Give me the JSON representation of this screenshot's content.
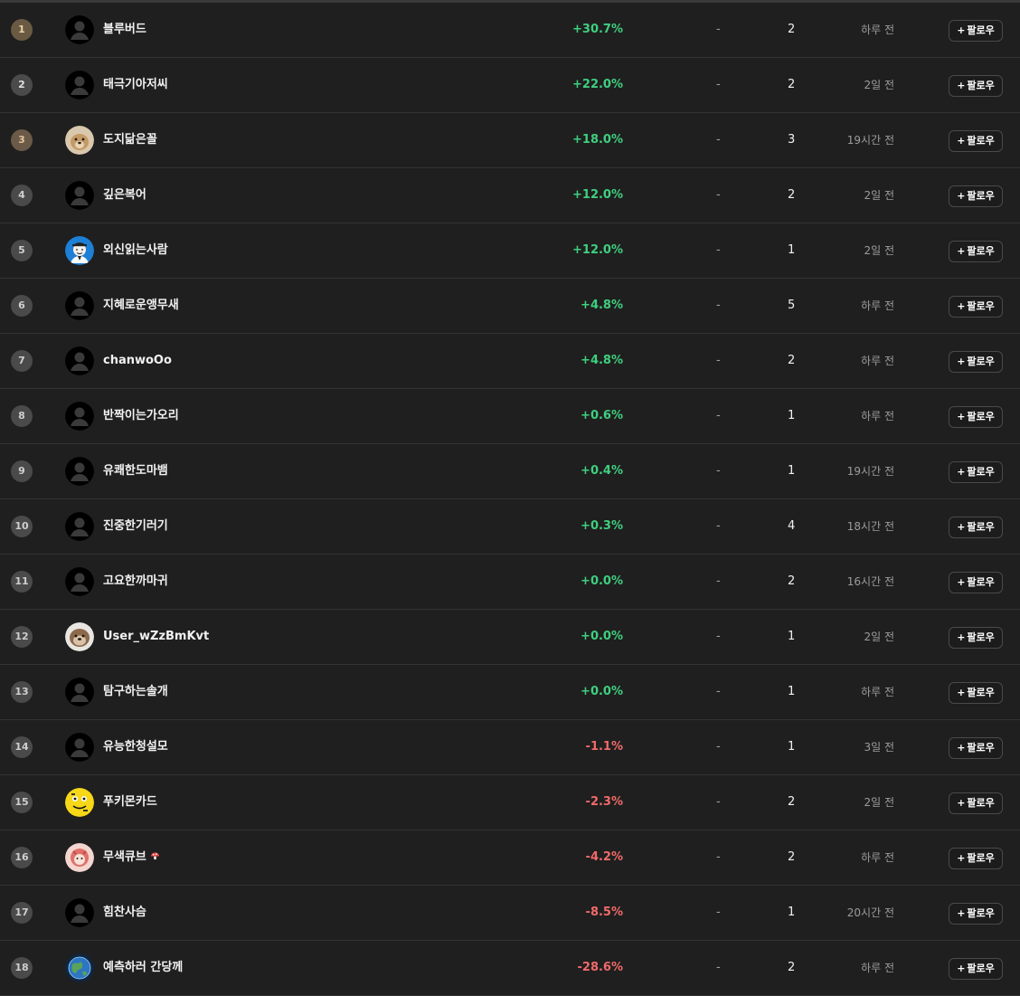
{
  "leaderboard": {
    "rows": [
      {
        "rank": "1",
        "name": "블루버드",
        "change": "+30.7%",
        "trend": "pos",
        "dash": "-",
        "count": "2",
        "time": "하루 전",
        "follow": "팔로우",
        "avatar": "default-avatar",
        "medal": "medal-1"
      },
      {
        "rank": "2",
        "name": "태극기아저씨",
        "change": "+22.0%",
        "trend": "pos",
        "dash": "-",
        "count": "2",
        "time": "2일 전",
        "follow": "팔로우",
        "avatar": "default-avatar",
        "medal": "medal-2"
      },
      {
        "rank": "3",
        "name": "도지닮은꼴",
        "change": "+18.0%",
        "trend": "pos",
        "dash": "-",
        "count": "3",
        "time": "19시간 전",
        "follow": "팔로우",
        "avatar": "dog-avatar",
        "medal": "medal-3"
      },
      {
        "rank": "4",
        "name": "깊은복어",
        "change": "+12.0%",
        "trend": "pos",
        "dash": "-",
        "count": "2",
        "time": "2일 전",
        "follow": "팔로우",
        "avatar": "default-avatar",
        "medal": ""
      },
      {
        "rank": "5",
        "name": "외신읽는사람",
        "change": "+12.0%",
        "trend": "pos",
        "dash": "-",
        "count": "1",
        "time": "2일 전",
        "follow": "팔로우",
        "avatar": "portrait-avatar",
        "medal": ""
      },
      {
        "rank": "6",
        "name": "지혜로운앵무새",
        "change": "+4.8%",
        "trend": "pos",
        "dash": "-",
        "count": "5",
        "time": "하루 전",
        "follow": "팔로우",
        "avatar": "default-avatar",
        "medal": ""
      },
      {
        "rank": "7",
        "name": "chanwoOo",
        "change": "+4.8%",
        "trend": "pos",
        "dash": "-",
        "count": "2",
        "time": "하루 전",
        "follow": "팔로우",
        "avatar": "default-avatar",
        "medal": ""
      },
      {
        "rank": "8",
        "name": "반짝이는가오리",
        "change": "+0.6%",
        "trend": "pos",
        "dash": "-",
        "count": "1",
        "time": "하루 전",
        "follow": "팔로우",
        "avatar": "default-avatar",
        "medal": ""
      },
      {
        "rank": "9",
        "name": "유쾌한도마뱀",
        "change": "+0.4%",
        "trend": "pos",
        "dash": "-",
        "count": "1",
        "time": "19시간 전",
        "follow": "팔로우",
        "avatar": "default-avatar",
        "medal": ""
      },
      {
        "rank": "10",
        "name": "진중한기러기",
        "change": "+0.3%",
        "trend": "pos",
        "dash": "-",
        "count": "4",
        "time": "18시간 전",
        "follow": "팔로우",
        "avatar": "default-avatar",
        "medal": ""
      },
      {
        "rank": "11",
        "name": "고요한까마귀",
        "change": "+0.0%",
        "trend": "pos",
        "dash": "-",
        "count": "2",
        "time": "16시간 전",
        "follow": "팔로우",
        "avatar": "default-avatar",
        "medal": ""
      },
      {
        "rank": "12",
        "name": "User_wZzBmKvt",
        "change": "+0.0%",
        "trend": "pos",
        "dash": "-",
        "count": "1",
        "time": "2일 전",
        "follow": "팔로우",
        "avatar": "otter-avatar",
        "medal": ""
      },
      {
        "rank": "13",
        "name": "탐구하는솔개",
        "change": "+0.0%",
        "trend": "pos",
        "dash": "-",
        "count": "1",
        "time": "하루 전",
        "follow": "팔로우",
        "avatar": "default-avatar",
        "medal": ""
      },
      {
        "rank": "14",
        "name": "유능한청설모",
        "change": "-1.1%",
        "trend": "neg",
        "dash": "-",
        "count": "1",
        "time": "3일 전",
        "follow": "팔로우",
        "avatar": "default-avatar",
        "medal": ""
      },
      {
        "rank": "15",
        "name": "푸키몬카드",
        "change": "-2.3%",
        "trend": "neg",
        "dash": "-",
        "count": "2",
        "time": "2일 전",
        "follow": "팔로우",
        "avatar": "yellow-face-avatar",
        "medal": ""
      },
      {
        "rank": "16",
        "name": "무색큐브",
        "change": "-4.2%",
        "trend": "neg",
        "dash": "-",
        "count": "2",
        "time": "하루 전",
        "follow": "팔로우",
        "avatar": "pink-character-avatar",
        "medal": "",
        "badge": "mushroom-icon"
      },
      {
        "rank": "17",
        "name": "힘찬사슴",
        "change": "-8.5%",
        "trend": "neg",
        "dash": "-",
        "count": "1",
        "time": "20시간 전",
        "follow": "팔로우",
        "avatar": "default-avatar",
        "medal": ""
      },
      {
        "rank": "18",
        "name": "예측하러 간당께",
        "change": "-28.6%",
        "trend": "neg",
        "dash": "-",
        "count": "2",
        "time": "하루 전",
        "follow": "팔로우",
        "avatar": "earth-avatar",
        "medal": ""
      }
    ]
  },
  "colors": {
    "background": "#1f1f1f",
    "positive": "#3fcf7f",
    "negative": "#f06a6a",
    "divider": "#333333"
  }
}
